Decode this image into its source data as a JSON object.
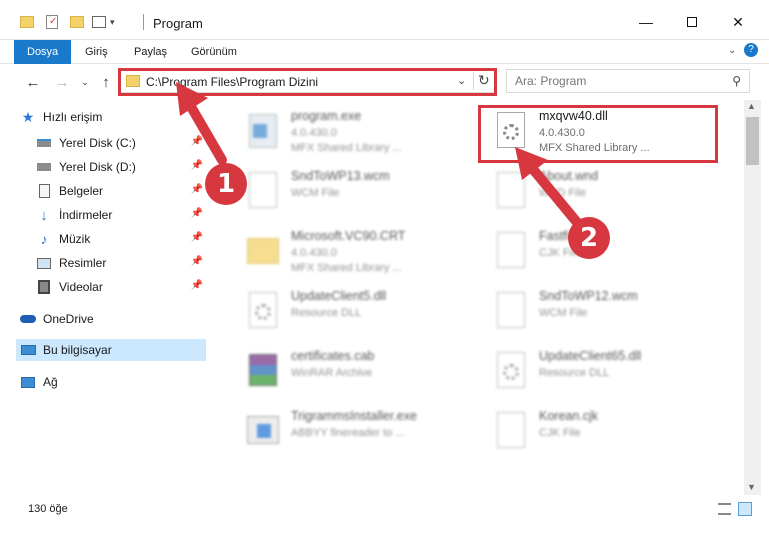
{
  "window": {
    "title": "Program"
  },
  "ribbon": {
    "tabs": [
      "Dosya",
      "Giriş",
      "Paylaş",
      "Görünüm"
    ]
  },
  "address": {
    "path": "C:\\Program Files\\Program Dizini",
    "search_placeholder": "Ara: Program"
  },
  "sidebar": {
    "items": [
      {
        "label": "Hızlı erişim",
        "icon": "star-icon"
      },
      {
        "label": "Yerel Disk (C:)",
        "icon": "drive-icon"
      },
      {
        "label": "Yerel Disk (D:)",
        "icon": "drive-icon"
      },
      {
        "label": "Belgeler",
        "icon": "document-icon"
      },
      {
        "label": "İndirmeler",
        "icon": "download-icon"
      },
      {
        "label": "Müzik",
        "icon": "music-icon"
      },
      {
        "label": "Resimler",
        "icon": "picture-icon"
      },
      {
        "label": "Videolar",
        "icon": "video-icon"
      },
      {
        "label": "OneDrive",
        "icon": "cloud-icon"
      },
      {
        "label": "Bu bilgisayar",
        "icon": "computer-icon"
      },
      {
        "label": "Ağ",
        "icon": "network-icon"
      }
    ]
  },
  "files": [
    {
      "name": "program.exe",
      "line1": "4.0.430.0",
      "line2": "MFX Shared Library ..."
    },
    {
      "name": "mxqvw40.dll",
      "line1": "4.0.430.0",
      "line2": "MFX Shared Library ..."
    },
    {
      "name": "SndToWP13.wcm",
      "line1": "WCM File",
      "line2": ""
    },
    {
      "name": "About.wnd",
      "line1": "WND File",
      "line2": ""
    },
    {
      "name": "Microsoft.VC90.CRT",
      "line1": "4.0.430.0",
      "line2": "MFX Shared Library ..."
    },
    {
      "name": "Fastfile.cjk",
      "line1": "CJK File",
      "line2": ""
    },
    {
      "name": "UpdateClient5.dll",
      "line1": "Resource DLL",
      "line2": ""
    },
    {
      "name": "SndToWP12.wcm",
      "line1": "WCM File",
      "line2": ""
    },
    {
      "name": "certificates.cab",
      "line1": "WinRAR Archive",
      "line2": ""
    },
    {
      "name": "UpdateClient65.dll",
      "line1": "Resource DLL",
      "line2": ""
    },
    {
      "name": "TrigrammsInstaller.exe",
      "line1": "ABBYY finereader to ...",
      "line2": ""
    },
    {
      "name": "Korean.cjk",
      "line1": "CJK File",
      "line2": ""
    }
  ],
  "status": {
    "count": "130 öğe"
  },
  "annotations": {
    "step1": "1",
    "step2": "2"
  },
  "colors": {
    "accent": "#1979ca",
    "highlight": "#d7373f",
    "selected": "#cce8ff"
  }
}
